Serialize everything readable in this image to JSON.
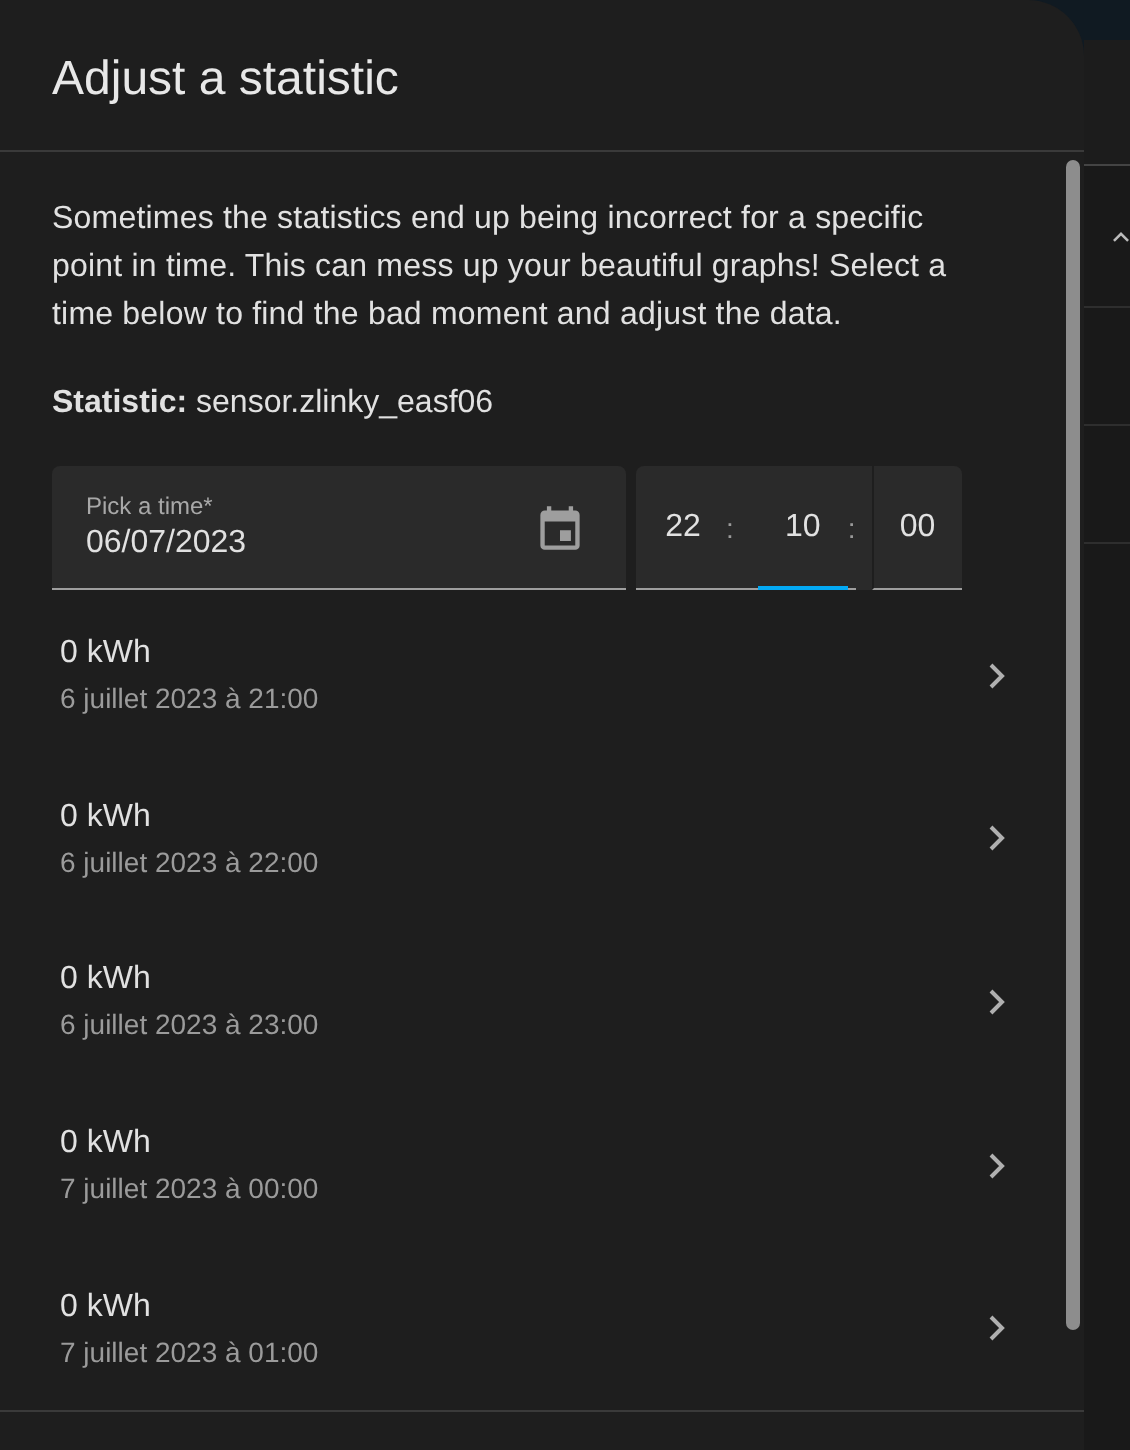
{
  "dialog": {
    "title": "Adjust a statistic",
    "description": "Sometimes the statistics end up being incorrect for a specific point in time. This can mess up your beautiful graphs! Select a time below to find the bad moment and adjust the data.",
    "statistic_label": "Statistic:",
    "statistic_value": "sensor.zlinky_easf06",
    "date_field": {
      "label": "Pick a time*",
      "value": "06/07/2023"
    },
    "time_field": {
      "segments": [
        {
          "value": "22",
          "focused": false
        },
        {
          "value": "10",
          "focused": true
        },
        {
          "value": "00",
          "focused": false
        }
      ],
      "separators": [
        ":",
        ":"
      ]
    },
    "entries": [
      {
        "value": "0 kWh",
        "time": "6 juillet 2023 à 21:00"
      },
      {
        "value": "0 kWh",
        "time": "6 juillet 2023 à 22:00"
      },
      {
        "value": "0 kWh",
        "time": "6 juillet 2023 à 23:00"
      },
      {
        "value": "0 kWh",
        "time": "7 juillet 2023 à 00:00"
      },
      {
        "value": "0 kWh",
        "time": "7 juillet 2023 à 01:00"
      }
    ]
  }
}
